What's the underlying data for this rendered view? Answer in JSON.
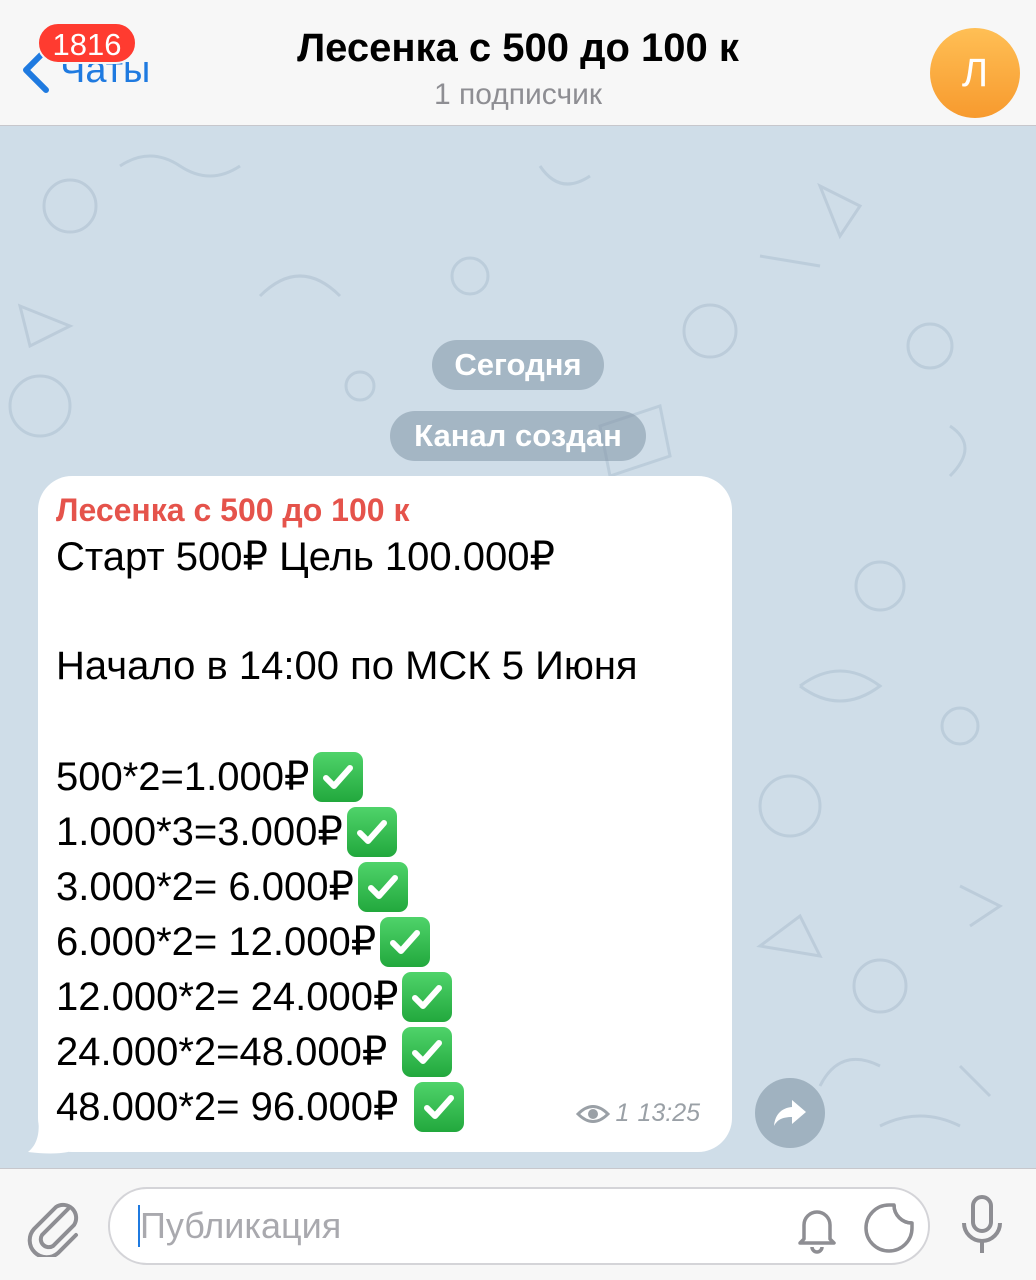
{
  "header": {
    "back_label": "Чаты",
    "unread_badge": "1816",
    "title": "Лесенка с 500 до 100 к",
    "subtitle": "1 подписчик",
    "avatar_letter": "Л"
  },
  "chat": {
    "date_pill": "Сегодня",
    "service_message": "Канал создан",
    "message": {
      "sender": "Лесенка с 500 до 100 к",
      "line_start": "Старт 500₽ Цель 100.000₽",
      "line_begin": "Начало в 14:00 по МСК 5 Июня",
      "steps": [
        {
          "text": "500*2=1.000₽",
          "done": true
        },
        {
          "text": "1.000*3=3.000₽",
          "done": true
        },
        {
          "text": "3.000*2= 6.000₽",
          "done": true
        },
        {
          "text": "6.000*2= 12.000₽",
          "done": true
        },
        {
          "text": "12.000*2= 24.000₽",
          "done": true
        },
        {
          "text": "24.000*2=48.000₽ ",
          "done": true
        },
        {
          "text": "48.000*2= 96.000₽ ",
          "done": true
        }
      ],
      "views": "1",
      "time": "13:25"
    }
  },
  "composer": {
    "placeholder": "Публикация"
  },
  "colors": {
    "accent": "#1f7ae0",
    "badge": "#ff3b30",
    "sender": "#e5534b",
    "check": "#2fbf4f",
    "chat_bg": "#cfdde8"
  },
  "icons": [
    "chevron-left-icon",
    "eye-icon",
    "forward-arrow-icon",
    "paperclip-icon",
    "bell-icon",
    "sticker-icon",
    "microphone-icon",
    "check-mark-icon"
  ]
}
